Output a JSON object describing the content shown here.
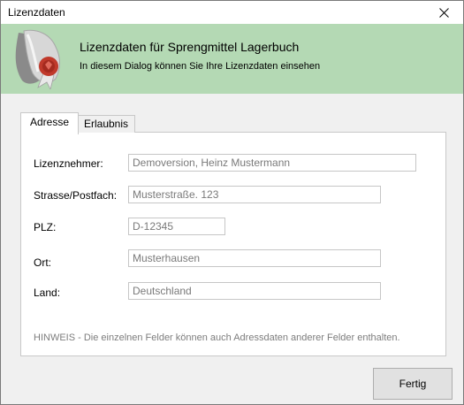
{
  "window": {
    "title": "Lizenzdaten"
  },
  "header": {
    "title": "Lizenzdaten für Sprengmittel Lagerbuch",
    "subtitle": "In diesem Dialog können Sie Ihre Lizenzdaten einsehen",
    "logo_icon": "sealed-scroll-icon"
  },
  "tabs": [
    {
      "label": "Adresse",
      "active": true
    },
    {
      "label": "Erlaubnis",
      "active": false
    }
  ],
  "form": {
    "fields": [
      {
        "label": "Lizenznehmer:",
        "value": "Demoversion, Heinz Mustermann"
      },
      {
        "label": "Strasse/Postfach:",
        "value": "Musterstraße. 123"
      },
      {
        "label": "PLZ:",
        "value": "D-12345"
      },
      {
        "label": "Ort:",
        "value": "Musterhausen"
      },
      {
        "label": "Land:",
        "value": "Deutschland"
      }
    ],
    "hint": "HINWEIS - Die einzelnen Felder können auch Adressdaten anderer Felder enthalten."
  },
  "buttons": {
    "done_label": "Fertig"
  },
  "colors": {
    "header_bg": "#b4d9b4",
    "seal_red": "#c0392b"
  }
}
